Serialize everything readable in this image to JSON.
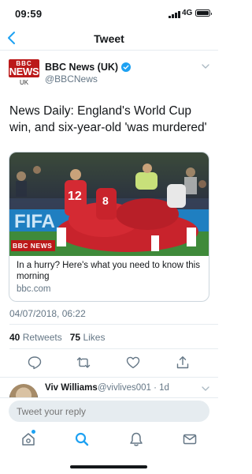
{
  "status_bar": {
    "time": "09:59",
    "network": "4G"
  },
  "header": {
    "title": "Tweet"
  },
  "tweet": {
    "author": {
      "avatar": {
        "line1": "BBC",
        "line2": "NEWS",
        "line3": "UK"
      },
      "name": "BBC News (UK)",
      "handle": "@BBCNews",
      "verified": true
    },
    "text": "News Daily: England's World Cup win, and six-year-old 'was murdered'",
    "card": {
      "image_logo": "BBC NEWS",
      "title": "In a hurry? Here's what you need to know this morning",
      "domain": "bbc.com"
    },
    "timestamp": "04/07/2018, 06:22",
    "stats": {
      "retweets_count": "40",
      "retweets_label": "Retweets",
      "likes_count": "75",
      "likes_label": "Likes"
    }
  },
  "reply_preview": {
    "name": "Viv Williams",
    "handle": "@vivlives001 · 1d"
  },
  "compose": {
    "placeholder": "Tweet your reply"
  },
  "tab_bar": {
    "items": [
      "home",
      "search",
      "notifications",
      "messages"
    ]
  },
  "colors": {
    "accent": "#1da1f2",
    "text": "#14171a",
    "secondary": "#657786",
    "bbc_red": "#bb1919"
  }
}
